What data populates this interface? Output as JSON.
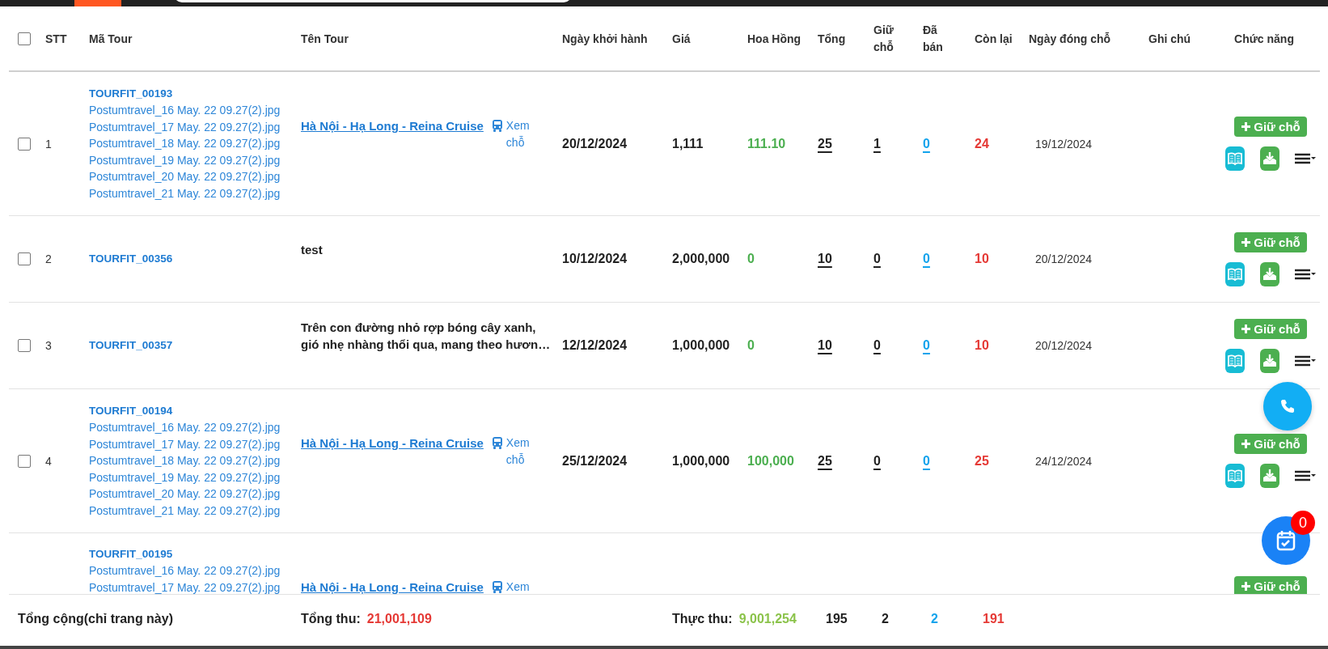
{
  "table": {
    "select_all": {
      "checked": false
    },
    "columns": [
      "STT",
      "Mã Tour",
      "Tên Tour",
      "Ngày khởi hành",
      "Giá",
      "Hoa Hồng",
      "Tổng",
      "Giữ chỗ",
      "Đã bán",
      "Còn lại",
      "Ngày đóng chỗ",
      "Ghi chú",
      "Chức năng"
    ],
    "rows": [
      {
        "kind": "full",
        "checked": false,
        "stt": "1",
        "code": "TOURFIT_00193",
        "files": [
          "Postumtravel_16 May. 22 09.27(2).jpg",
          "Postumtravel_17 May. 22 09.27(2).jpg",
          "Postumtravel_18 May. 22 09.27(2).jpg",
          "Postumtravel_19 May. 22 09.27(2).jpg",
          "Postumtravel_20 May. 22 09.27(2).jpg",
          "Postumtravel_21 May. 22 09.27(2).jpg"
        ],
        "title": {
          "kind": "link",
          "text": "Hà Nội - Hạ Long - Reina Cruise",
          "extra": "Xem chỗ"
        },
        "departure": "20/12/2024",
        "price": "1,111",
        "commission": "111.10",
        "total": "25",
        "held": "1",
        "sold": "0",
        "remaining": "24",
        "closing": "19/12/2024",
        "hold_label": "Giữ chỗ"
      },
      {
        "kind": "full",
        "checked": false,
        "stt": "2",
        "code": "TOURFIT_00356",
        "title": {
          "kind": "plain",
          "text": "test"
        },
        "departure": "10/12/2024",
        "price": "2,000,000",
        "commission": "0",
        "total": "10",
        "held": "0",
        "sold": "0",
        "remaining": "10",
        "closing": "20/12/2024",
        "hold_label": "Giữ chỗ"
      },
      {
        "kind": "full",
        "checked": false,
        "stt": "3",
        "code": "TOURFIT_00357",
        "title": {
          "kind": "plain",
          "text": "Trên con đường nhỏ rợp bóng cây xanh,\ngió nhẹ nhàng thổi qua, mang theo hươn…"
        },
        "departure": "12/12/2024",
        "price": "1,000,000",
        "commission": "0",
        "total": "10",
        "held": "0",
        "sold": "0",
        "remaining": "10",
        "closing": "20/12/2024",
        "hold_label": "Giữ chỗ"
      },
      {
        "kind": "full",
        "checked": false,
        "stt": "4",
        "code": "TOURFIT_00194",
        "files": [
          "Postumtravel_16 May. 22 09.27(2).jpg",
          "Postumtravel_17 May. 22 09.27(2).jpg",
          "Postumtravel_18 May. 22 09.27(2).jpg",
          "Postumtravel_19 May. 22 09.27(2).jpg",
          "Postumtravel_20 May. 22 09.27(2).jpg",
          "Postumtravel_21 May. 22 09.27(2).jpg"
        ],
        "title": {
          "kind": "link",
          "text": "Hà Nội - Hạ Long - Reina Cruise",
          "extra": "Xem chỗ"
        },
        "departure": "25/12/2024",
        "price": "1,000,000",
        "commission": "100,000",
        "total": "25",
        "held": "0",
        "sold": "0",
        "remaining": "25",
        "closing": "24/12/2024",
        "hold_label": "Giữ chỗ"
      },
      {
        "kind": "cut",
        "code": "TOURFIT_00195",
        "files": [
          "Postumtravel_16 May. 22 09.27(2).jpg",
          "Postumtravel_17 May. 22 09.27(2).jpg"
        ],
        "title": {
          "kind": "link",
          "text": "Hà Nội - Hạ Long - Reina Cruise",
          "extra": "Xem"
        },
        "hold_label": "Giữ chỗ"
      }
    ],
    "footer": {
      "label": "Tổng cộng(chỉ trang này)",
      "revenue_label": "Tổng thu:",
      "revenue": "21,001,109",
      "net_label": "Thực thu:",
      "net": "9,001,254",
      "total": "195",
      "held": "2",
      "sold": "2",
      "remaining": "191"
    }
  },
  "floating": {
    "notification_count": "0"
  }
}
